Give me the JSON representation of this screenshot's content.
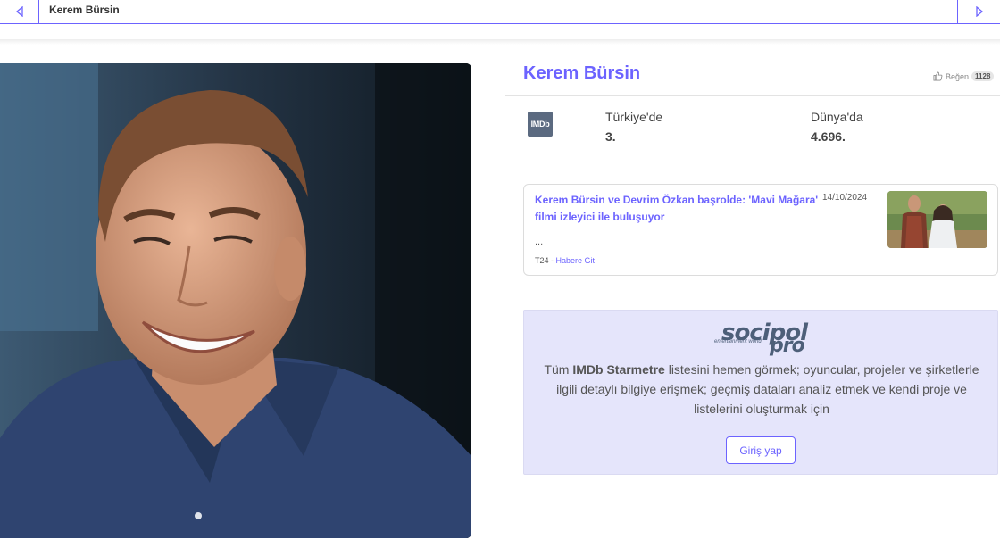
{
  "breadcrumb": {
    "title": "Kerem Bürsin"
  },
  "person": {
    "name": "Kerem Bürsin",
    "like_label": "Beğen",
    "like_count": "1128"
  },
  "ranking": {
    "badge": "IMDb",
    "turkey_label": "Türkiye'de",
    "turkey_value": "3.",
    "world_label": "Dünya'da",
    "world_value": "4.696."
  },
  "news": {
    "title": "Kerem Bürsin ve Devrim Özkan başrolde: 'Mavi Mağara' filmi izleyici ile buluşuyor",
    "date": "14/10/2024",
    "excerpt": "...",
    "source": "T24 - ",
    "link_label": "Habere Git"
  },
  "promo": {
    "logo_main": "socipol",
    "logo_sub": "entertainment world",
    "logo_pro": "pro",
    "text_1": "Tüm ",
    "text_imdb": "IMDb Starmetre",
    "text_2": " listesini hemen görmek; oyuncular, projeler ve şirketlerle ilgili detaylı bilgiye erişmek; geçmiş dataları analiz etmek ve kendi proje ve listelerini oluşturmak için",
    "login_label": "Giriş yap"
  },
  "colors": {
    "accent": "#6c63ff",
    "promo_bg": "#e5e5fb",
    "badge": "#5b6a80"
  },
  "icons": {
    "prev": "triangle-left-icon",
    "next": "triangle-right-icon",
    "like": "thumbs-up-icon"
  }
}
